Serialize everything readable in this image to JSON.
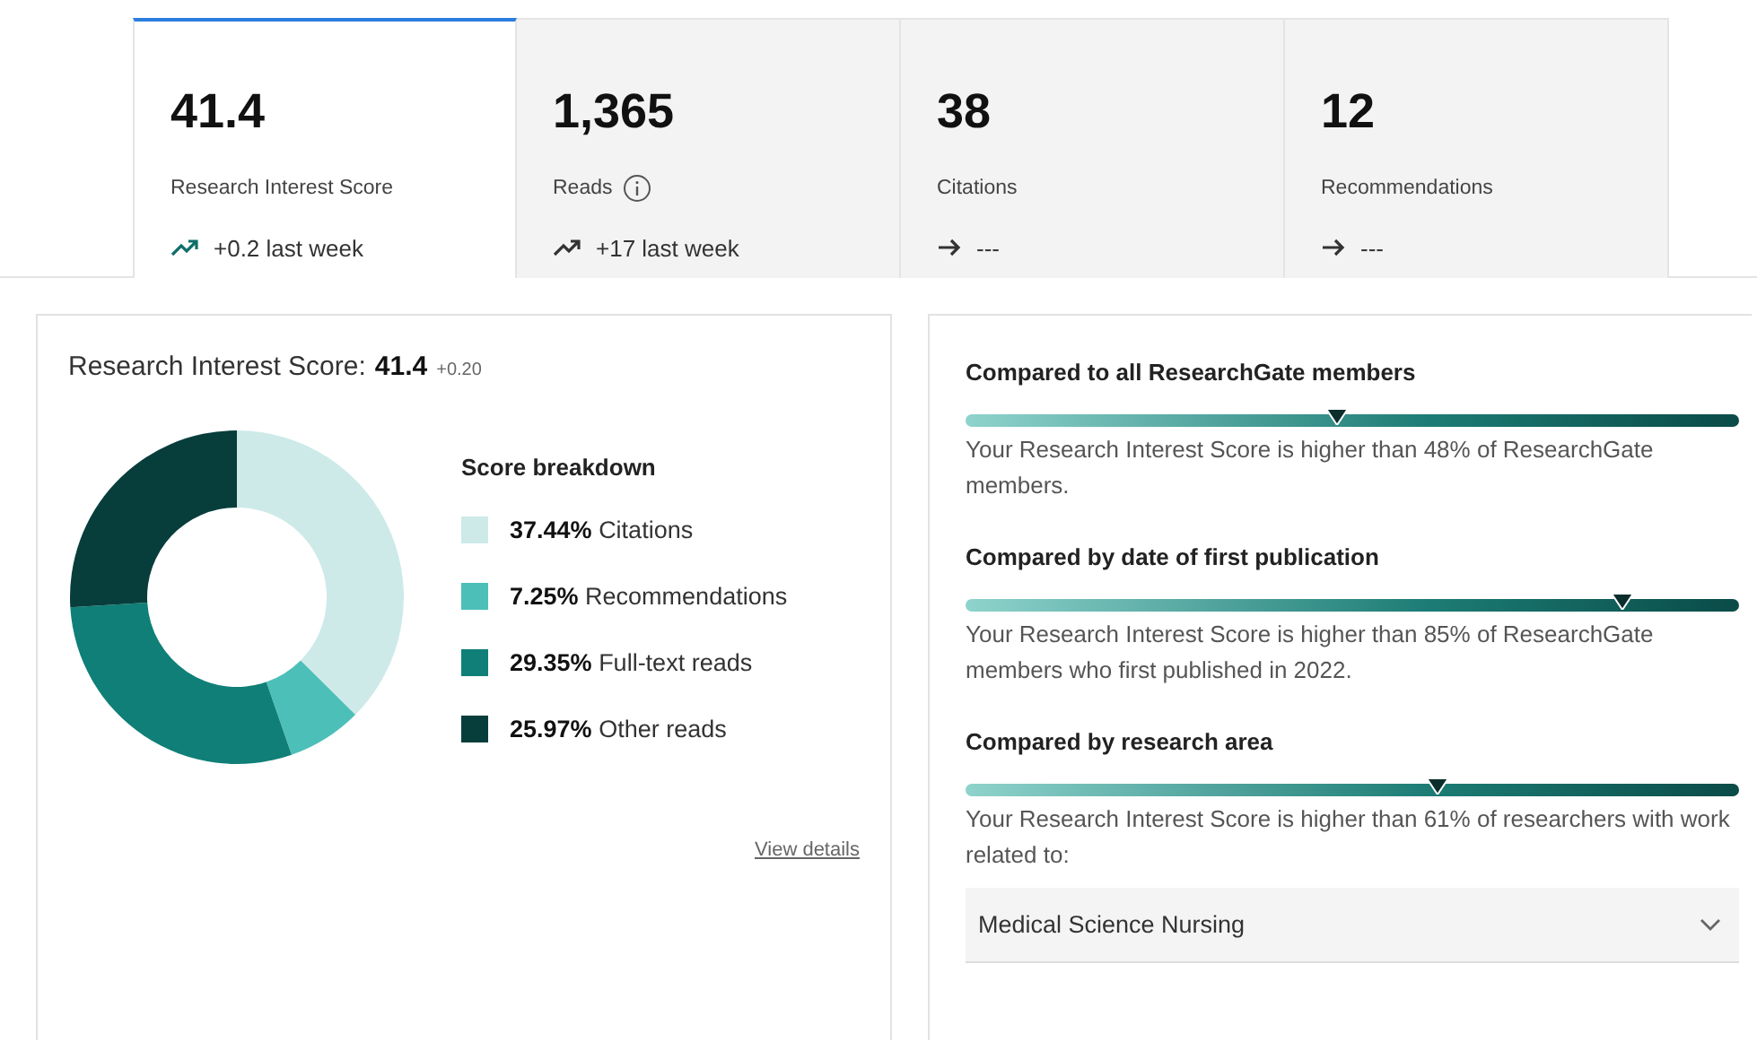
{
  "tabs": [
    {
      "value": "41.4",
      "label": "Research Interest Score",
      "info": false,
      "trend": {
        "kind": "up",
        "text": "+0.2 last week"
      },
      "selected": true
    },
    {
      "value": "1,365",
      "label": "Reads",
      "info": true,
      "trend": {
        "kind": "up",
        "text": "+17 last week"
      },
      "selected": false
    },
    {
      "value": "38",
      "label": "Citations",
      "info": false,
      "trend": {
        "kind": "flat",
        "text": "---"
      },
      "selected": false
    },
    {
      "value": "12",
      "label": "Recommendations",
      "info": false,
      "trend": {
        "kind": "flat",
        "text": "---"
      },
      "selected": false
    }
  ],
  "score_card": {
    "title": "Research Interest Score:",
    "score": "41.4",
    "delta": "+0.20",
    "legend_title": "Score breakdown",
    "legend": [
      {
        "percent": "37.44%",
        "label": "Citations",
        "color": "#cdeae9"
      },
      {
        "percent": "7.25%",
        "label": "Recommendations",
        "color": "#4dbfb9"
      },
      {
        "percent": "29.35%",
        "label": "Full-text reads",
        "color": "#0f7f77"
      },
      {
        "percent": "25.97%",
        "label": "Other reads",
        "color": "#073e3c"
      }
    ],
    "chart_data": {
      "type": "donut",
      "values": [
        37.44,
        7.25,
        29.35,
        25.97
      ]
    },
    "link": "View details"
  },
  "comparisons": [
    {
      "heading": "Compared to all ResearchGate members",
      "level": 0.48,
      "text": "Your Research Interest Score is higher than 48% of ResearchGate members."
    },
    {
      "heading": "Compared by date of first publication",
      "level": 0.85,
      "text": "Your Research Interest Score is higher than 85% of ResearchGate members who first published in 2022."
    },
    {
      "heading": "Compared by research area",
      "level": 0.61,
      "text": "Your Research Interest Score is higher than 61% of researchers with work related to:"
    }
  ],
  "area_select": {
    "value": "Medical Science Nursing"
  }
}
